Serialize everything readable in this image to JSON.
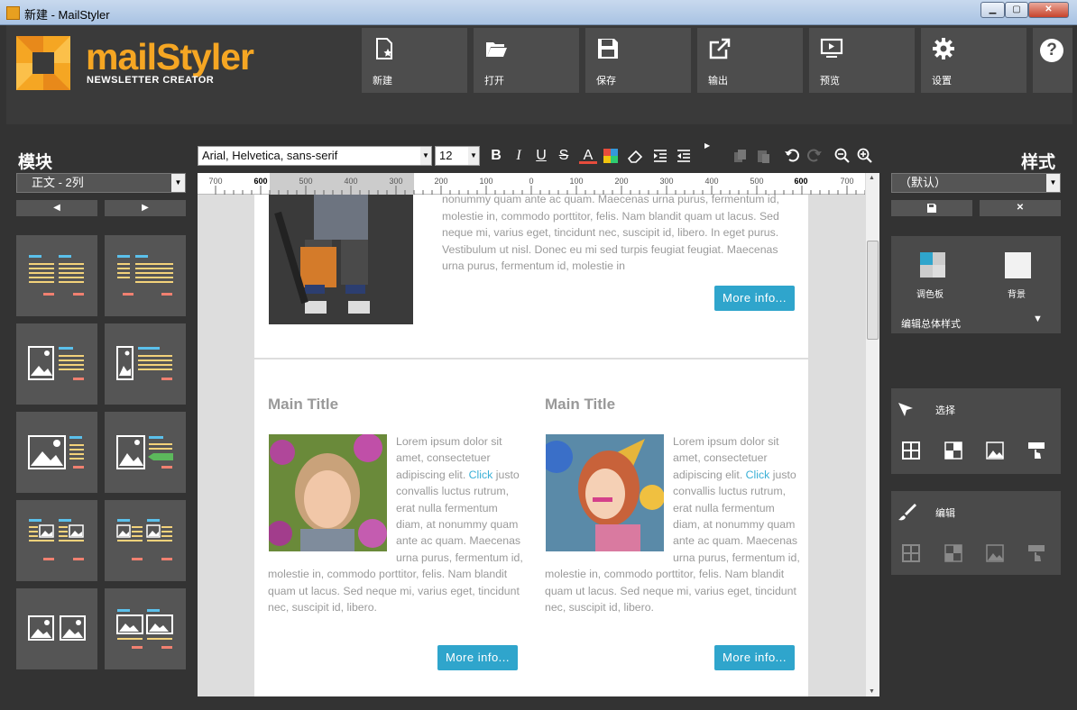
{
  "window": {
    "title": "新建 - MailStyler",
    "minimize": "▁",
    "maximize": "▢",
    "close": "✕"
  },
  "logo": {
    "name": "mailStyler",
    "subtitle": "NEWSLETTER CREATOR"
  },
  "toolbar": [
    {
      "label": "新建",
      "icon": "new-doc-icon"
    },
    {
      "label": "打开",
      "icon": "folder-open-icon"
    },
    {
      "label": "保存",
      "icon": "save-icon"
    },
    {
      "label": "输出",
      "icon": "export-icon"
    },
    {
      "label": "预览",
      "icon": "preview-icon"
    },
    {
      "label": "设置",
      "icon": "gear-icon"
    }
  ],
  "help_label": "?",
  "blocks_panel": {
    "title": "模块",
    "select_value": "正文 - 2列",
    "prev": "◀",
    "next": "▶"
  },
  "format": {
    "font": "Arial, Helvetica, sans-serif",
    "size": "12",
    "bold": "B",
    "italic": "I",
    "underline": "U",
    "strike": "S",
    "color": "A"
  },
  "ruler": [
    "700",
    "600",
    "500",
    "400",
    "300",
    "200",
    "100",
    "0",
    "100",
    "200",
    "300",
    "400",
    "500",
    "600",
    "700"
  ],
  "content": {
    "top_text": "Nonummy convallis luctus rutrum, erat nulla fermentum diam, at nonummy quam ante ac quam. Maecenas urna purus, fermentum id, molestie in, commodo porttitor, felis. Nam blandit quam ut lacus. Sed neque mi, varius eget, tincidunt nec, suscipit id, libero. In eget purus. Vestibulum ut nisl. Donec eu mi sed turpis feugiat feugiat. Maecenas urna purus, fermentum id, molestie in",
    "more": "More info...",
    "col1": {
      "title": "Main Title",
      "text1": "Lorem ipsum dolor sit amet, consectetuer adipiscing elit. ",
      "link": "Click",
      "text2": " justo convallis luctus rutrum, erat nulla fermentum diam, at nonummy quam ante ac quam. Maecenas urna purus, fermentum id, molestie in, commodo porttitor, felis. Nam blandit quam ut lacus. Sed neque mi, varius eget, tincidunt nec, suscipit id, libero.",
      "more": "More info..."
    },
    "col2": {
      "title": "Main Title",
      "text1": "Lorem ipsum dolor sit amet, consectetuer adipiscing elit. ",
      "link": "Click",
      "text2": " justo convallis luctus rutrum, erat nulla fermentum diam, at nonummy quam ante ac quam. Maecenas urna purus, fermentum id, molestie in, commodo porttitor, felis. Nam blandit quam ut lacus. Sed neque mi, varius eget, tincidunt nec, suscipit id, libero.",
      "more": "More info..."
    }
  },
  "styles_panel": {
    "title": "样式",
    "select_value": "（默认）",
    "palette": "调色板",
    "background": "背景",
    "edit_global": "编辑总体样式",
    "select_label": "选择",
    "edit_label": "编辑"
  },
  "colors": {
    "accent": "#f5a623",
    "button": "#2fa5cc"
  }
}
